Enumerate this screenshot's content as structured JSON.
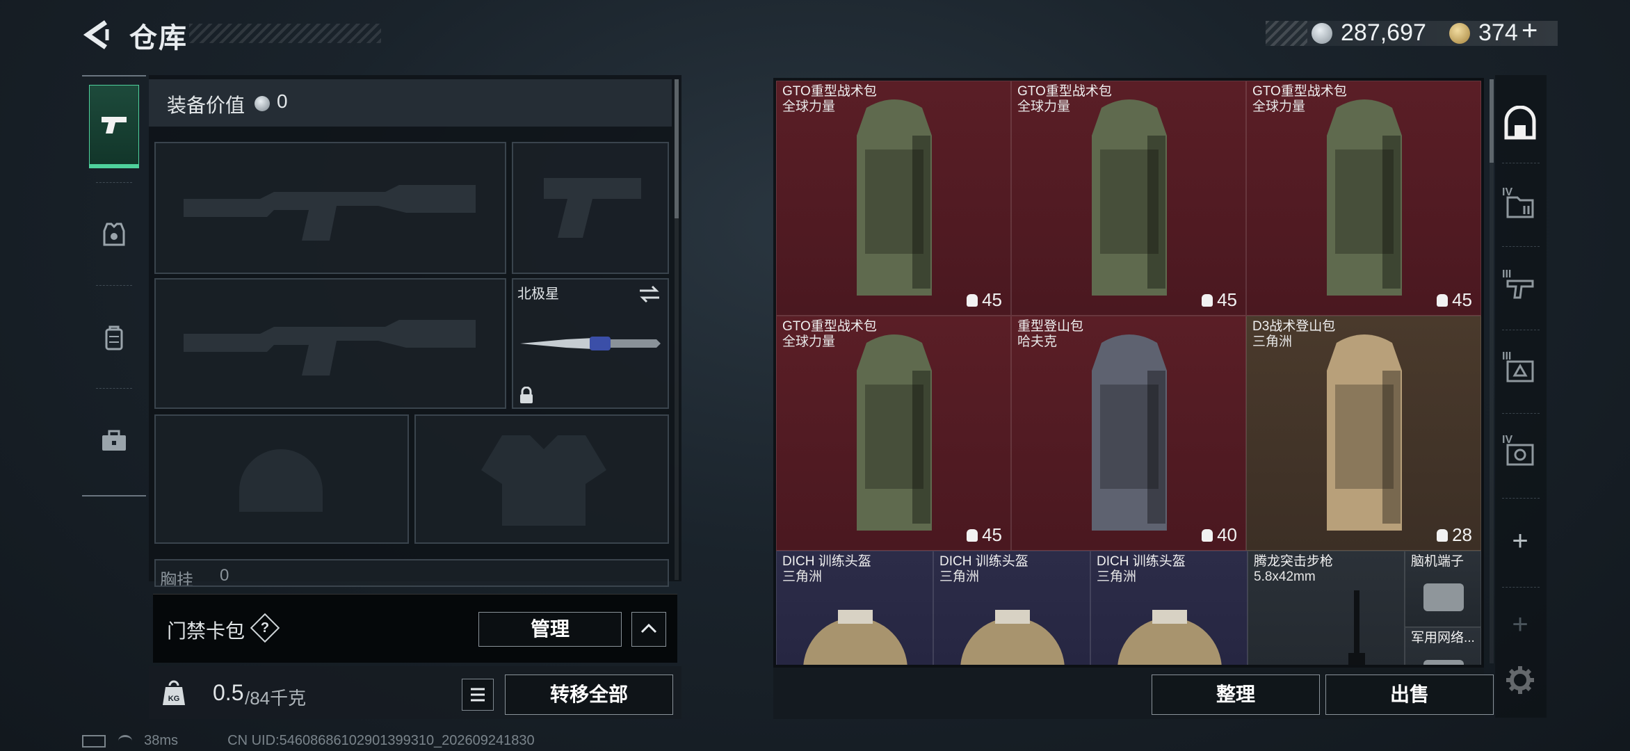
{
  "header": {
    "title": "仓库",
    "money": "287,697",
    "coupons": "374",
    "add_label": "+"
  },
  "equipment": {
    "value_label": "装备价值",
    "value": "0",
    "melee_name": "北极星",
    "chest_label": "胸挂",
    "chest_value": "0"
  },
  "keycard": {
    "label": "门禁卡包",
    "help": "?",
    "manage": "管理"
  },
  "weight": {
    "current": "0.5",
    "max": "/84千克",
    "transfer_all": "转移全部"
  },
  "inventory": {
    "items": [
      {
        "name": "GTO重型战术包",
        "sub": "全球力量",
        "cap": "45",
        "color": "red"
      },
      {
        "name": "GTO重型战术包",
        "sub": "全球力量",
        "cap": "45",
        "color": "red"
      },
      {
        "name": "GTO重型战术包",
        "sub": "全球力量",
        "cap": "45",
        "color": "red"
      },
      {
        "name": "GTO重型战术包",
        "sub": "全球力量",
        "cap": "45",
        "color": "red"
      },
      {
        "name": "重型登山包",
        "sub": "哈夫克",
        "cap": "40",
        "color": "red"
      },
      {
        "name": "D3战术登山包",
        "sub": "三角洲",
        "cap": "28",
        "color": "brown"
      },
      {
        "name": "DICH 训练头盔",
        "sub": "三角洲",
        "color": "purple"
      },
      {
        "name": "DICH 训练头盔",
        "sub": "三角洲",
        "color": "purple"
      },
      {
        "name": "DICH 训练头盔",
        "sub": "三角洲",
        "color": "purple"
      },
      {
        "name": "腾龙突击步枪",
        "sub": "5.8x42mm",
        "color": "gray"
      },
      {
        "name": "脑机端子",
        "sub": "",
        "color": "gray"
      },
      {
        "name": "军用网络...",
        "sub": "",
        "color": "gray"
      }
    ],
    "sort": "整理",
    "sell": "出售"
  },
  "right_rail": {
    "roman": [
      "IV",
      "III",
      "III",
      "IV"
    ],
    "add": "+"
  },
  "status": {
    "ping": "38ms",
    "uid": "CN UID:5460868610290139931​0_202609241830"
  },
  "colors": {
    "accent": "#4fd19c",
    "legendary_red": "#5a1e26",
    "rare_brown": "#4a3a2c",
    "epic_purple": "#2c2c48"
  }
}
